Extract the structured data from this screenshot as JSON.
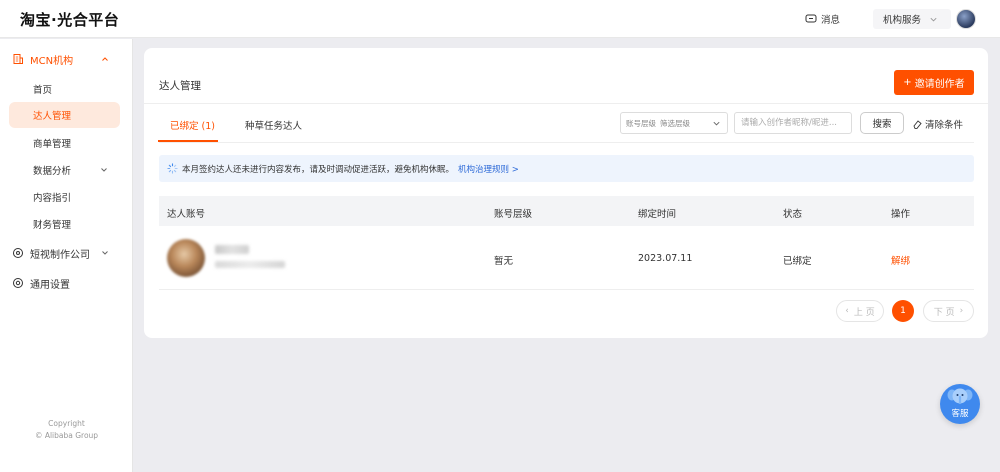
{
  "header": {
    "logo": "淘宝·光合平台",
    "message_label": "消息",
    "org_label": "机构服务"
  },
  "sidebar": {
    "groups": [
      {
        "label": "MCN机构",
        "active": true
      },
      {
        "label": "短视制作公司"
      },
      {
        "label": "通用设置"
      }
    ],
    "items": [
      {
        "label": "首页"
      },
      {
        "label": "达人管理",
        "active": true
      },
      {
        "label": "商单管理"
      },
      {
        "label": "数据分析"
      },
      {
        "label": "内容指引"
      },
      {
        "label": "财务管理"
      }
    ],
    "copyright_line1": "Copyright",
    "copyright_line2": "© Alibaba Group"
  },
  "main": {
    "title": "达人管理",
    "invite_label": "邀请创作者",
    "tabs": [
      {
        "label": "已绑定 (1)",
        "active": true
      },
      {
        "label": "种草任务达人"
      }
    ],
    "filter": {
      "select_label": "账号层级",
      "select_value": "筛选层级",
      "search_placeholder": "请输入创作者昵称/昵进...",
      "search_label": "搜索",
      "clear_label": "清除条件"
    },
    "notice": {
      "text": "本月签约达人还未进行内容发布，请及时调动促进活跃，避免机构休眠。",
      "link": "机构治理规则 >"
    },
    "table": {
      "headers": [
        "达人账号",
        "账号层级",
        "绑定时间",
        "状态",
        "操作"
      ],
      "rows": [
        {
          "level": "暂无",
          "bind_time": "2023.07.11",
          "status": "已绑定",
          "action": "解绑"
        }
      ]
    },
    "pagination": {
      "prev_label": "上 页",
      "next_label": "下 页",
      "current_page": "1"
    }
  },
  "support": {
    "label": "客服"
  },
  "colors": {
    "accent": "#ff5000",
    "link": "#2f6bd8",
    "notice_bg": "#eef4fd",
    "support": "#3f89ee"
  }
}
